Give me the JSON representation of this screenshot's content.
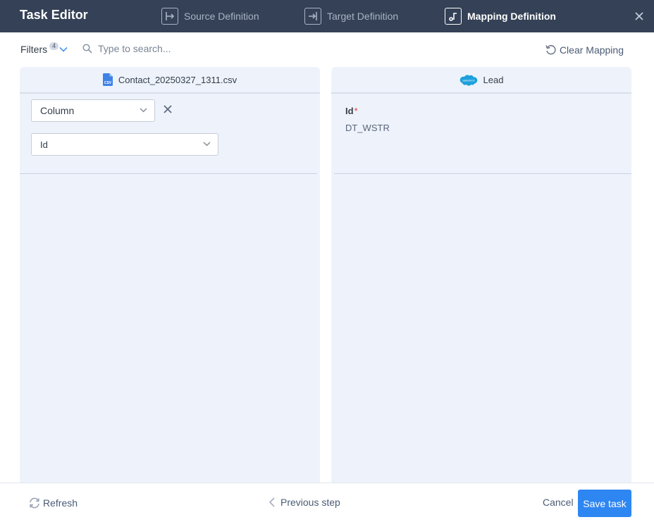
{
  "header": {
    "title": "Task Editor",
    "steps": [
      {
        "label": "Source Definition",
        "icon": "source-step-icon",
        "active": false
      },
      {
        "label": "Target Definition",
        "icon": "target-step-icon",
        "active": false
      },
      {
        "label": "Mapping Definition",
        "icon": "mapping-step-icon",
        "active": true
      }
    ],
    "close_icon": "close-icon"
  },
  "toolbar": {
    "filters_label": "Filters",
    "filters_count": "4",
    "search_placeholder": "Type to search...",
    "search_value": "",
    "clear_mapping_label": "Clear Mapping"
  },
  "source_panel": {
    "title": "Contact_20250327_1311.csv",
    "file_icon_text": "CSV",
    "mapping_type": "Column",
    "mapping_value": "Id"
  },
  "target_panel": {
    "title": "Lead",
    "logo_text": "salesforce",
    "field": {
      "name": "Id",
      "required_mark": "*",
      "type": "DT_WSTR"
    }
  },
  "footer": {
    "refresh_label": "Refresh",
    "previous_label": "Previous step",
    "cancel_label": "Cancel",
    "save_label": "Save task"
  },
  "colors": {
    "header_bg": "#344156",
    "panel_bg": "#eef3fb",
    "accent": "#2e86f2",
    "required": "#e0413b",
    "salesforce": "#1ea0dc"
  }
}
